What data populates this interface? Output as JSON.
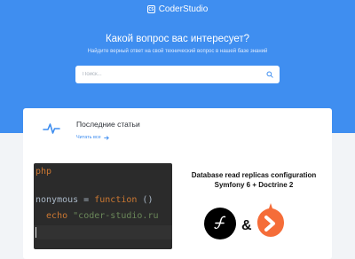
{
  "brand": {
    "logo_text": "CS",
    "name": "CoderStudio"
  },
  "hero": {
    "title": "Какой вопрос вас интересует?",
    "subtitle": "Найдите верный ответ на свой технический вопрос в нашей базе знаний",
    "search": {
      "placeholder": "Поиск..."
    },
    "background_color": "#3f8ef0"
  },
  "section": {
    "title": "Последние статьи",
    "read_all": "Читать все",
    "icon": "pulse-icon"
  },
  "articles": [
    {
      "thumbnail": "code-screenshot",
      "code_lines": [
        {
          "text": "php"
        },
        {
          "text": ""
        },
        {
          "text_a": "nonymous = ",
          "text_b": "function",
          "text_c": " ()"
        },
        {
          "text_a": "  echo ",
          "text_b": "\"coder-studio.ru"
        }
      ]
    },
    {
      "thumbnail": "article-cover",
      "title_line1": "Database read replicas configuration",
      "title_line2": "Symfony 6 + Doctrine 2",
      "amp": "&"
    }
  ],
  "colors": {
    "accent": "#3f8ef0",
    "background": "#f2f4f7",
    "doctrine": "#f56d39",
    "symfony": "#000000"
  }
}
